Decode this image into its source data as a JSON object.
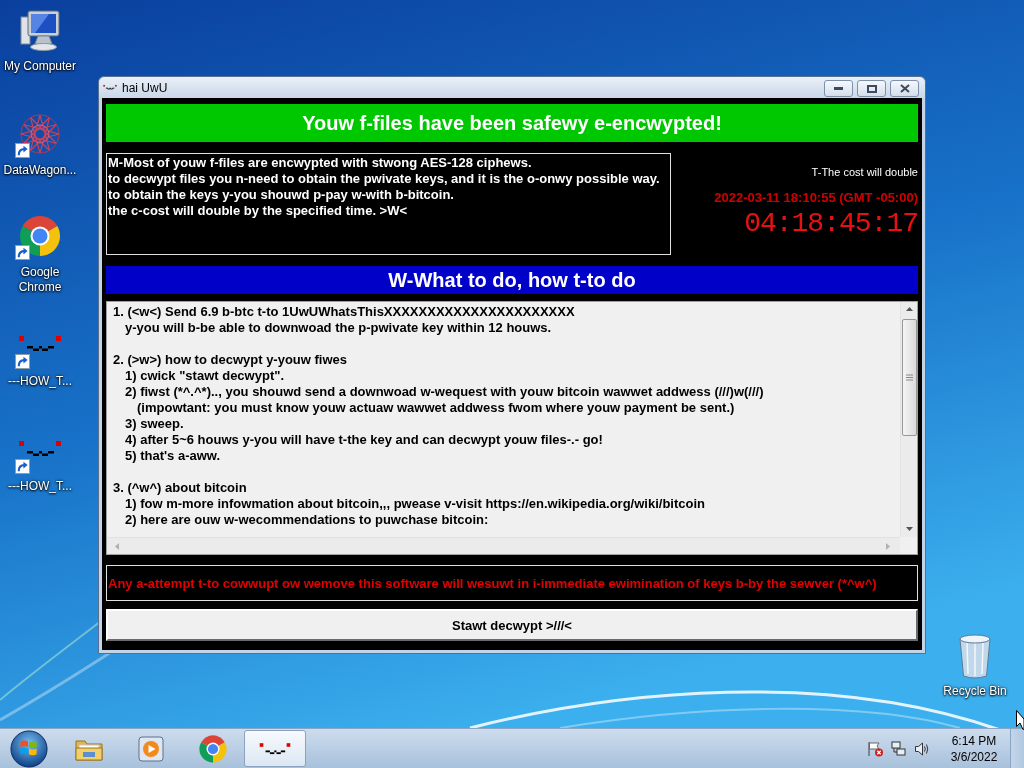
{
  "desktop_icons": [
    {
      "kind": "computer",
      "label": "My Computer",
      "shortcut": false
    },
    {
      "kind": "network",
      "label": "DataWagon...",
      "shortcut": true
    },
    {
      "kind": "browser",
      "label": "Google Chrome",
      "shortcut": true
    },
    {
      "kind": "emoticon",
      "label": "---HOW_T...",
      "shortcut": true
    },
    {
      "kind": "emoticon",
      "label": "---HOW_T...",
      "shortcut": true
    }
  ],
  "recycle_bin": {
    "label": "Recycle Bin"
  },
  "window": {
    "title": "hai UwU",
    "banner": "Youw f-files have been safewy e-encwypted!",
    "message_lines": [
      "M-Most of youw f-files are encwypted with stwong AES-128 ciphews.",
      "to decwypt files you n-need to obtain the pwivate keys, and it is the o-onwy possible way.",
      "to obtain the keys y-you shouwd p-pay w-with b-bitcoin.",
      "the c-cost will double by the specified time. >W<"
    ],
    "cost_notice": "T-The cost will double",
    "deadline": "2022-03-11 18:10:55 (GMT -05:00)",
    "countdown": "04:18:45:17",
    "section_heading": "W-What to do, how t-to do",
    "instructions": [
      {
        "text": "1. (<w<) Send 6.9 b-btc t-to 1UwUWhatsThisXXXXXXXXXXXXXXXXXXXXXX",
        "children": [
          {
            "text": "y-you will b-be able to downwoad the p-pwivate key within 12 houws."
          }
        ]
      },
      {
        "text": "2. (>w>) how to decwypt y-youw fiwes",
        "children": [
          {
            "text": "1) cwick \"stawt decwypt\"."
          },
          {
            "text": "2) fiwst (*^.^*).., you shouwd send a downwoad w-wequest with youw bitcoin wawwet addwess (///)w(///)",
            "children": [
              {
                "text": "(impowtant: you must know youw actuaw wawwet addwess fwom where youw payment be sent.)"
              }
            ]
          },
          {
            "text": "3) sweep."
          },
          {
            "text": "4) after 5~6 houws y-you will have t-the key and can decwypt youw files-.- go!"
          },
          {
            "text": "5) that's a-aww."
          }
        ]
      },
      {
        "text": "3. (^w^) about bitcoin",
        "children": [
          {
            "text": "1) fow m-more infowmation about bitcoin,,, pwease v-visit https://en.wikipedia.org/wiki/bitcoin"
          },
          {
            "text": "2) here are ouw w-wecommendations to puwchase bitcoin:"
          }
        ]
      }
    ],
    "warning": "Any a-attempt t-to cowwupt ow wemove this software will wesuwt in i-immediate ewimination of keys b-by the sewver (*^w^)",
    "decrypt_button": "Stawt decwypt >///<"
  },
  "taskbar": {
    "items": [
      {
        "kind": "folder",
        "selected": false
      },
      {
        "kind": "media",
        "selected": false
      },
      {
        "kind": "browser",
        "selected": false
      },
      {
        "kind": "emoticon",
        "selected": true
      }
    ],
    "clock": {
      "time": "6:14 PM",
      "date": "3/6/2022"
    }
  }
}
